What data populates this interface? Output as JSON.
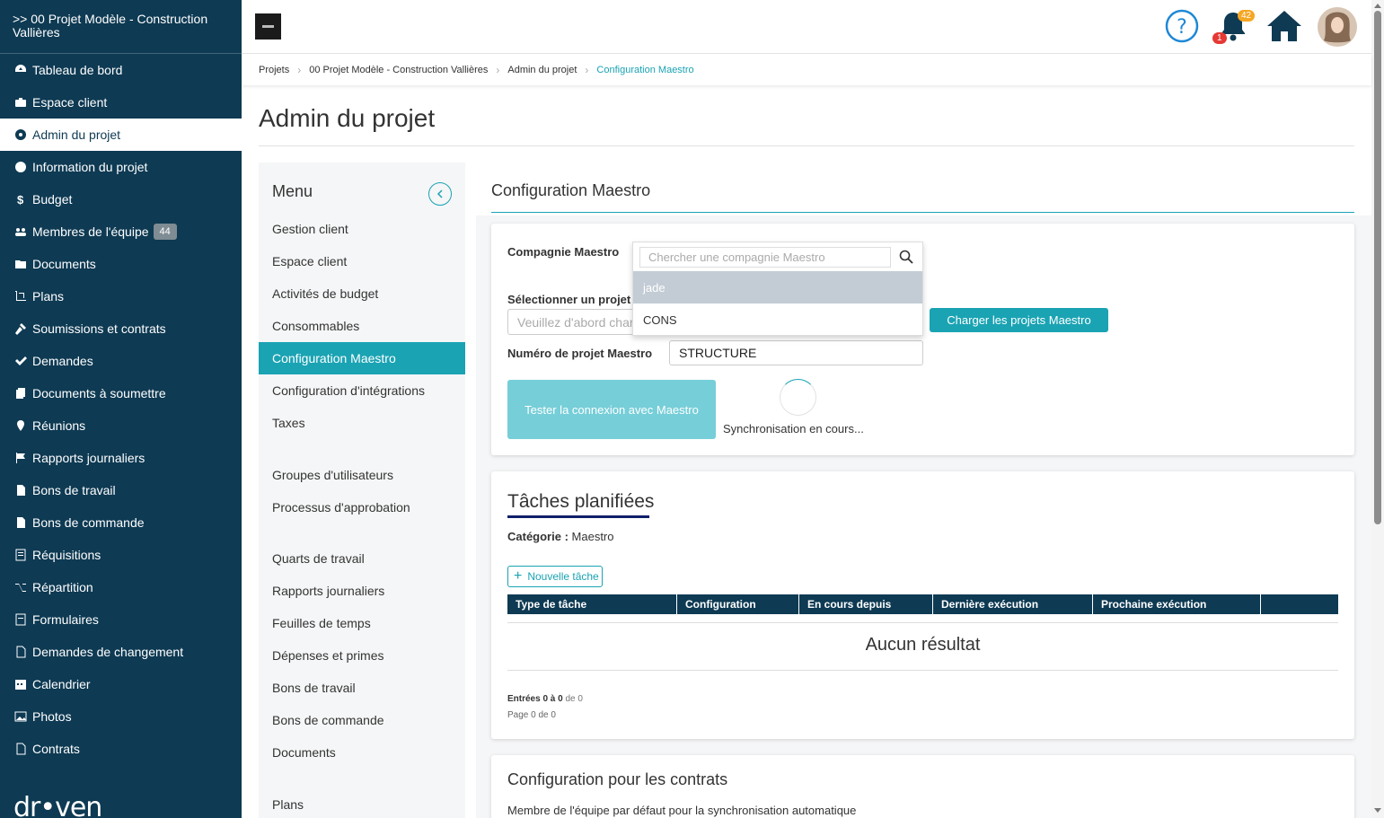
{
  "nav": {
    "project_title": ">> 00 Projet Modèle - Construction Vallières",
    "items": [
      {
        "label": "Tableau de bord",
        "icon": "dashboard-icon"
      },
      {
        "label": "Espace client",
        "icon": "briefcase-icon"
      },
      {
        "label": "Admin du projet",
        "icon": "gear-icon",
        "active": true
      },
      {
        "label": "Information du projet",
        "icon": "info-icon"
      },
      {
        "label": "Budget",
        "icon": "dollar-icon"
      },
      {
        "label": "Membres de l'équipe",
        "icon": "users-icon",
        "badge": "44"
      },
      {
        "label": "Documents",
        "icon": "folder-icon"
      },
      {
        "label": "Plans",
        "icon": "crop-icon"
      },
      {
        "label": "Soumissions et contrats",
        "icon": "gavel-icon"
      },
      {
        "label": "Demandes",
        "icon": "check-icon"
      },
      {
        "label": "Documents à soumettre",
        "icon": "copy-icon"
      },
      {
        "label": "Réunions",
        "icon": "map-pin-icon"
      },
      {
        "label": "Rapports journaliers",
        "icon": "flag-icon"
      },
      {
        "label": "Bons de travail",
        "icon": "file-icon"
      },
      {
        "label": "Bons de commande",
        "icon": "file-icon"
      },
      {
        "label": "Réquisitions",
        "icon": "list-icon"
      },
      {
        "label": "Répartition",
        "icon": "shuffle-icon"
      },
      {
        "label": "Formulaires",
        "icon": "form-icon"
      },
      {
        "label": "Demandes de changement",
        "icon": "file-outline-icon"
      },
      {
        "label": "Calendrier",
        "icon": "calendar-icon"
      },
      {
        "label": "Photos",
        "icon": "image-icon"
      },
      {
        "label": "Contrats",
        "icon": "file-outline-icon"
      }
    ],
    "brand": "dr•ven"
  },
  "topbar": {
    "notifications_count": "42",
    "alerts_count": "1",
    "colors": {
      "help": "#1e88d6",
      "home": "#0e3a53",
      "badge_orange": "#f5a623",
      "badge_red": "#e53935"
    }
  },
  "breadcrumb": {
    "items": [
      "Projets",
      "00 Projet Modèle - Construction Vallières",
      "Admin du projet"
    ],
    "current": "Configuration Maestro"
  },
  "page": {
    "title": "Admin du projet"
  },
  "submenu": {
    "title": "Menu",
    "items": [
      {
        "label": "Gestion client"
      },
      {
        "label": "Espace client"
      },
      {
        "label": "Activités de budget"
      },
      {
        "label": "Consommables"
      },
      {
        "label": "Configuration Maestro",
        "active": true
      },
      {
        "label": "Configuration d'intégrations"
      },
      {
        "label": "Taxes"
      },
      {
        "label": "Groupes d'utilisateurs"
      },
      {
        "label": "Processus d'approbation"
      },
      {
        "label": "Quarts de travail"
      },
      {
        "label": "Rapports journaliers"
      },
      {
        "label": "Feuilles de temps"
      },
      {
        "label": "Dépenses et primes"
      },
      {
        "label": "Bons de travail"
      },
      {
        "label": "Bons de commande"
      },
      {
        "label": "Documents"
      },
      {
        "label": "Plans"
      }
    ]
  },
  "maestro": {
    "title": "Configuration Maestro",
    "company_label": "Compagnie Maestro",
    "search_placeholder": "Chercher une compagnie Maestro",
    "options": [
      "jade",
      "CONS"
    ],
    "select_project_label": "Sélectionner un projet",
    "select_project_placeholder": "Veuillez d'abord charger",
    "load_button": "Charger les projets Maestro",
    "project_number_label": "Numéro de projet Maestro",
    "project_number_value": "STRUCTURE",
    "test_button": "Tester la connexion avec Maestro",
    "sync_status": "Synchronisation en cours..."
  },
  "tasks": {
    "title": "Tâches planifiées",
    "category_label": "Catégorie :",
    "category_value": "Maestro",
    "new_task_button": "Nouvelle tâche",
    "columns": [
      "Type de tâche",
      "Configuration",
      "En cours depuis",
      "Dernière exécution",
      "Prochaine exécution",
      ""
    ],
    "empty": "Aucun résultat",
    "entries_bold": "Entrées 0 à 0",
    "entries_rest": "de 0",
    "page_info": "Page 0 de 0"
  },
  "contracts": {
    "title": "Configuration pour les contrats",
    "desc": "Membre de l'équipe par défaut pour la synchronisation automatique"
  }
}
